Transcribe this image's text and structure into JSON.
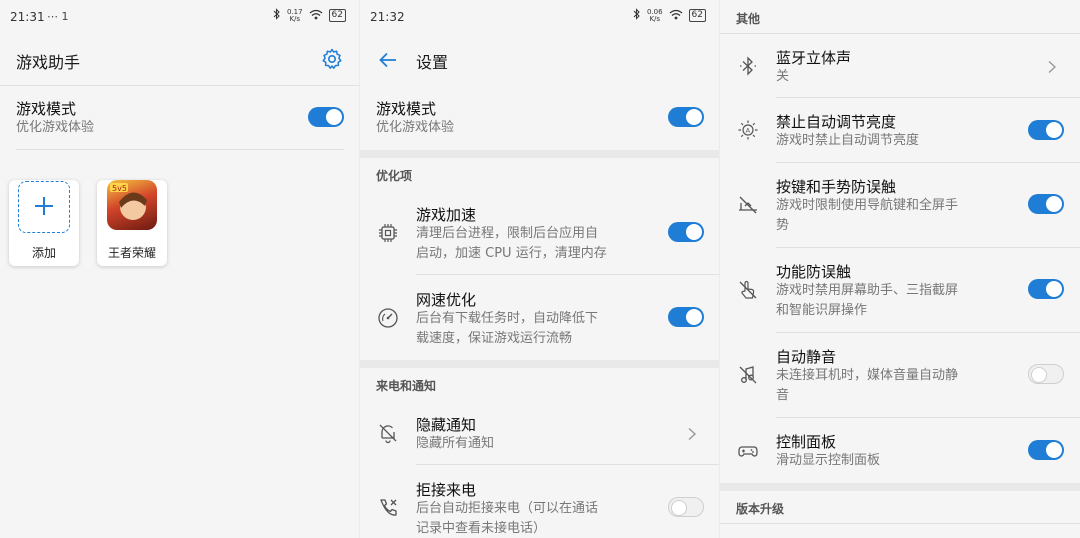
{
  "panel1": {
    "status": {
      "time": "21:31",
      "extra": "⋯ 1",
      "speed_top": "0.17",
      "speed_unit": "K/s",
      "battery": "62"
    },
    "title": "游戏助手",
    "game_mode": {
      "title": "游戏模式",
      "subtitle": "优化游戏体验",
      "enabled": true
    },
    "apps": [
      {
        "label": "添加",
        "icon": "plus-icon"
      },
      {
        "label": "王者荣耀",
        "icon": "honor-of-kings-app-icon"
      }
    ]
  },
  "panel2": {
    "status": {
      "time": "21:32",
      "speed_top": "0.06",
      "speed_unit": "K/s",
      "battery": "62"
    },
    "title": "设置",
    "game_mode": {
      "title": "游戏模式",
      "subtitle": "优化游戏体验",
      "enabled": true
    },
    "section_optimize": "优化项",
    "game_boost": {
      "title": "游戏加速",
      "subtitle_1": "清理后台进程，限制后台应用自",
      "subtitle_2": "启动，加速 CPU 运行，清理内存",
      "enabled": true
    },
    "network_opt": {
      "title": "网速优化",
      "subtitle_1": "后台有下载任务时，自动降低下",
      "subtitle_2": "载速度，保证游戏运行流畅",
      "enabled": true
    },
    "section_calls": "来电和通知",
    "hide_notif": {
      "title": "隐藏通知",
      "subtitle": "隐藏所有通知"
    },
    "reject_calls": {
      "title": "拒接来电",
      "subtitle_1": "后台自动拒接来电（可以在通话",
      "subtitle_2": "记录中查看未接电话）",
      "enabled": false
    }
  },
  "panel3": {
    "section_other": "其他",
    "bt_stereo": {
      "title": "蓝牙立体声",
      "subtitle": "关"
    },
    "brightness": {
      "title": "禁止自动调节亮度",
      "subtitle": "游戏时禁止自动调节亮度",
      "enabled": true
    },
    "mistouch": {
      "title": "按键和手势防误触",
      "subtitle_1": "游戏时限制使用导航键和全屏手",
      "subtitle_2": "势",
      "enabled": true
    },
    "func_mistouch": {
      "title": "功能防误触",
      "subtitle_1": "游戏时禁用屏幕助手、三指截屏",
      "subtitle_2": "和智能识屏操作",
      "enabled": true
    },
    "auto_mute": {
      "title": "自动静音",
      "subtitle_1": "未连接耳机时，媒体音量自动静",
      "subtitle_2": "音",
      "enabled": false
    },
    "control_panel": {
      "title": "控制面板",
      "subtitle": "滑动显示控制面板",
      "enabled": true
    },
    "section_version": "版本升级"
  },
  "colors": {
    "accent": "#1f7dd6",
    "toggle_off": "#f0f0f0",
    "background": "#f5f5f5"
  }
}
